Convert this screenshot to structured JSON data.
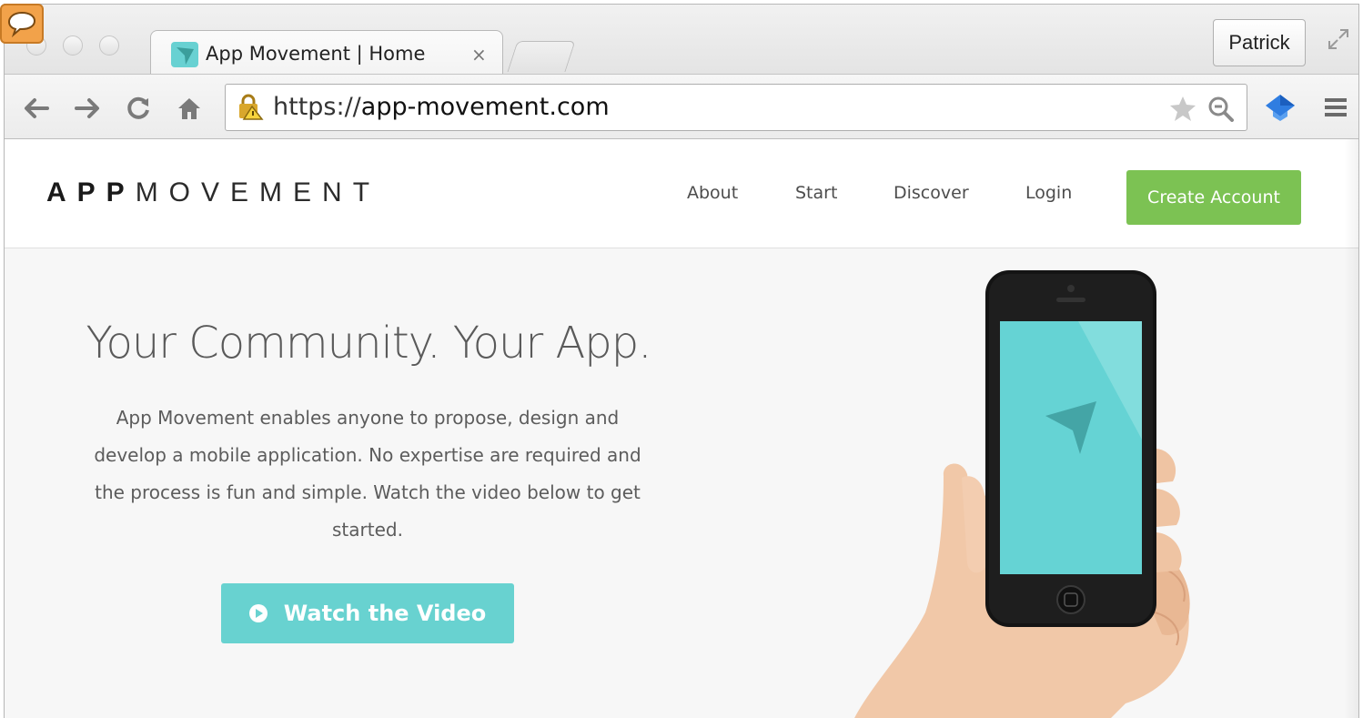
{
  "browser": {
    "tab": {
      "title": "App Movement | Home",
      "close": "×"
    },
    "profile_name": "Patrick",
    "url": {
      "scheme": "https://",
      "host": "app-movement.com"
    }
  },
  "site": {
    "brand": {
      "bold": "APP",
      "light": "MOVEMENT"
    },
    "nav": [
      {
        "label": "About"
      },
      {
        "label": "Start"
      },
      {
        "label": "Discover"
      },
      {
        "label": "Login"
      }
    ],
    "create_account": "Create Account",
    "hero": {
      "title": "Your Community. Your App.",
      "text": "App Movement enables anyone to propose, design and develop a mobile application. No expertise are required and the process is fun and simple. Watch the video below to get started.",
      "button": "Watch the Video"
    }
  },
  "colors": {
    "accent_teal": "#68d2d0",
    "accent_green": "#7cc253"
  },
  "icons": {
    "extension_badge": "speech-bubble-icon",
    "favicon": "paper-plane-icon",
    "back": "arrow-left-icon",
    "forward": "arrow-right-icon",
    "reload": "reload-icon",
    "home": "home-icon",
    "lock": "warning-lock-icon",
    "bookmark": "star-icon",
    "zoom": "magnifier-icon",
    "extension": "graduation-cap-icon",
    "menu": "hamburger-menu-icon",
    "fullscreen": "fullscreen-icon",
    "play": "play-circle-icon"
  }
}
